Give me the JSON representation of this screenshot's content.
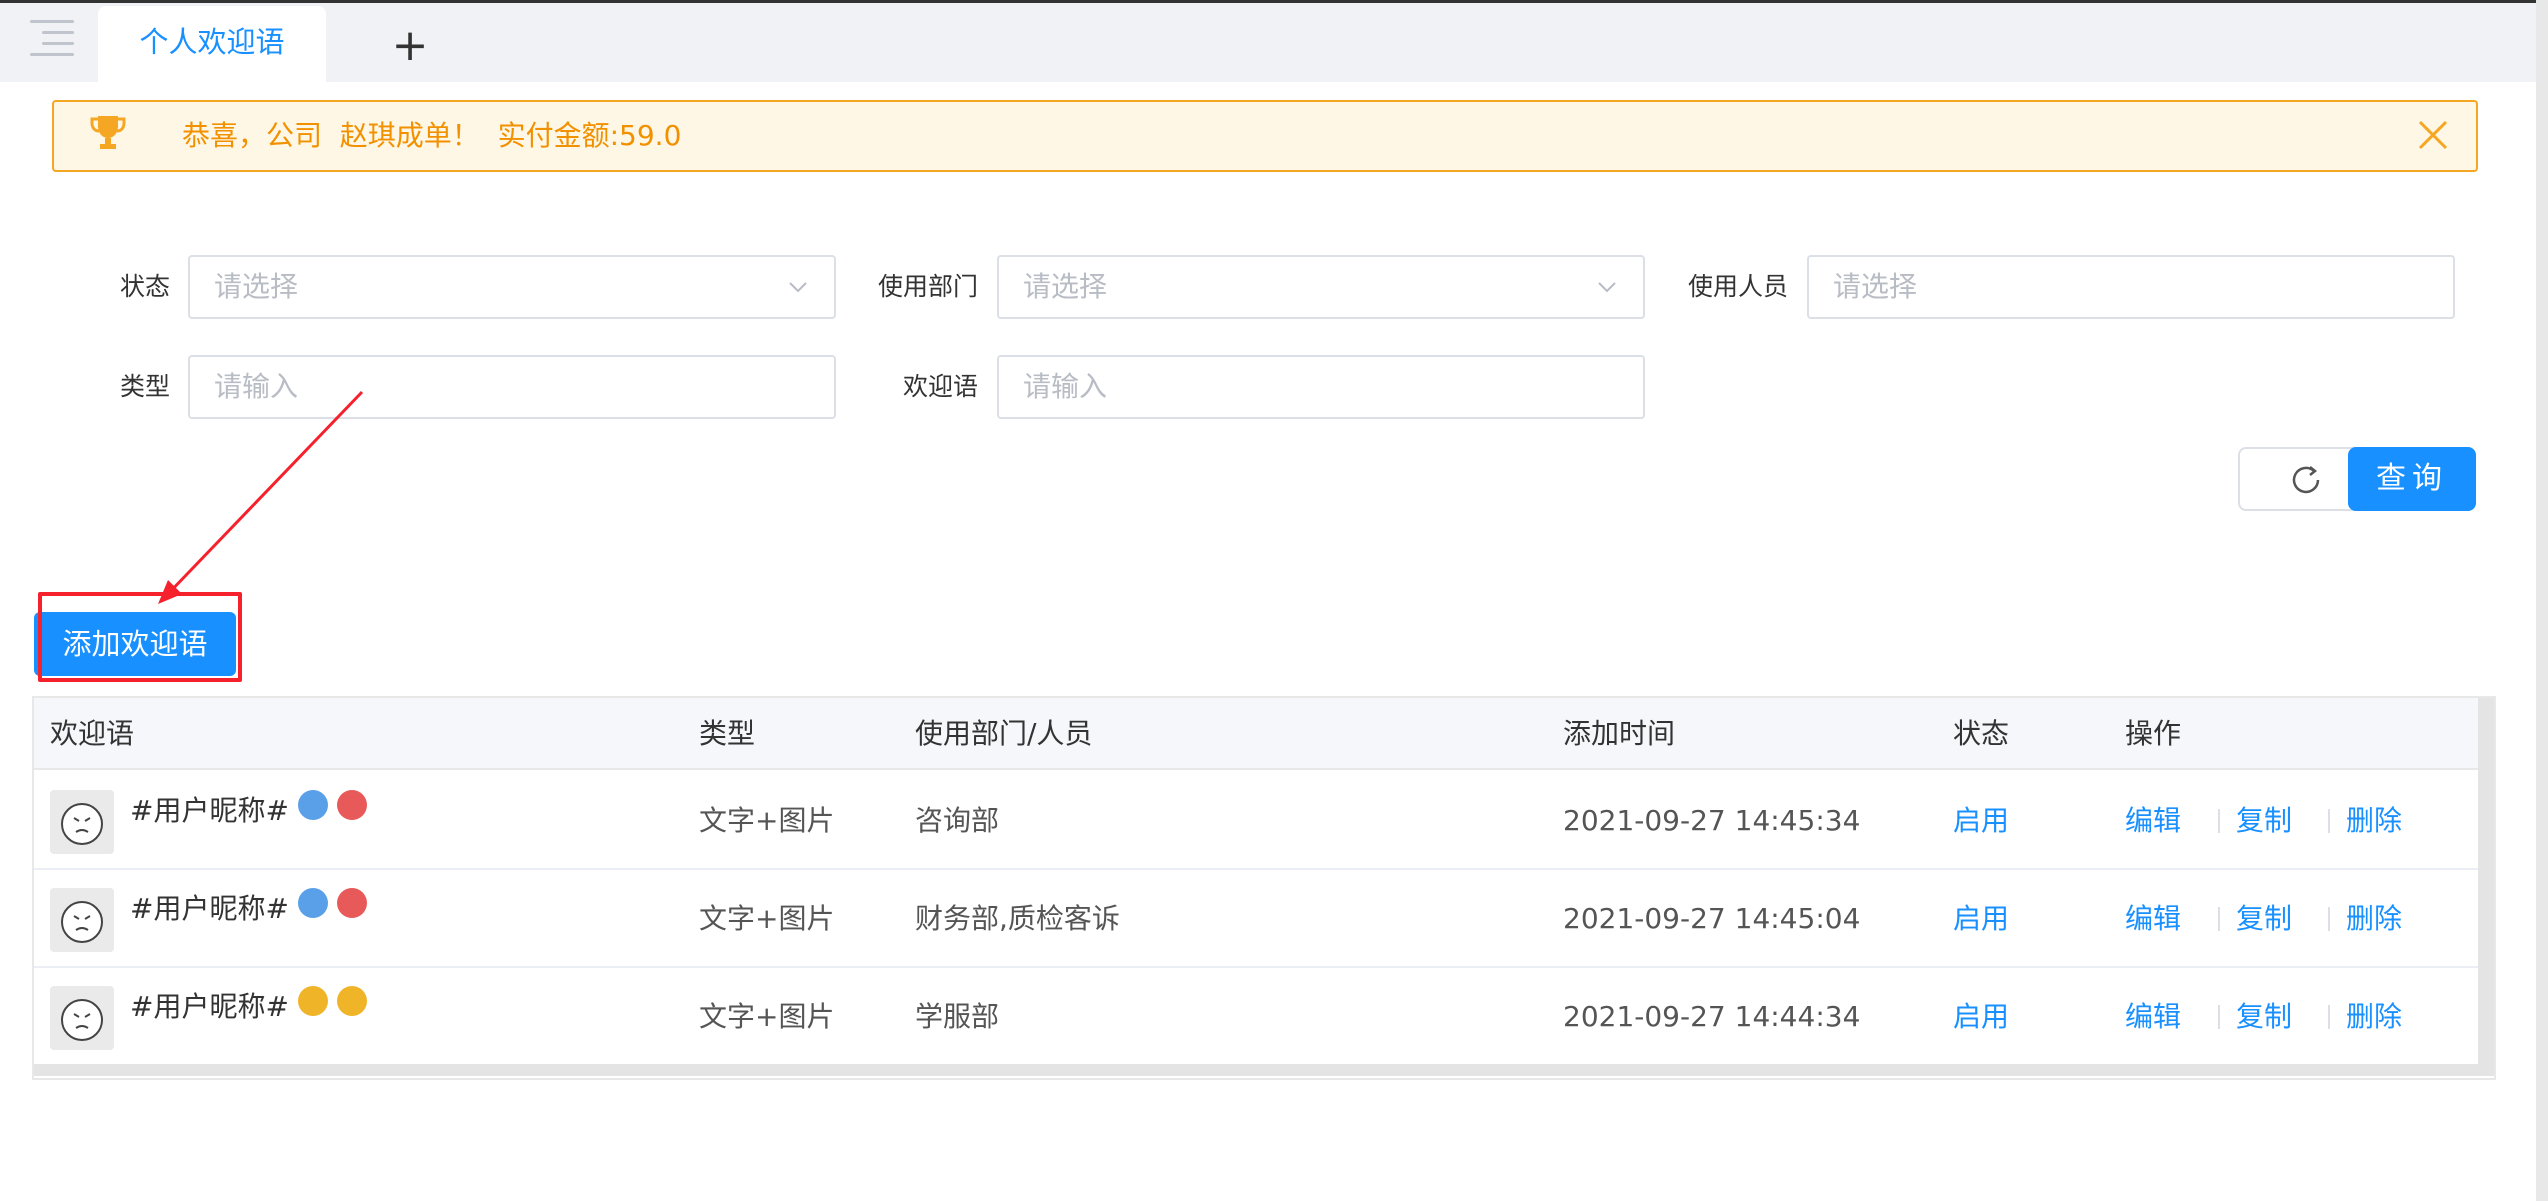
{
  "tabs": {
    "active_label": "个人欢迎语",
    "add_label": "+"
  },
  "notice": {
    "text": "恭喜，公司  赵琪成单！  实付金额:59.0"
  },
  "filters": {
    "status_label": "状态",
    "status_placeholder": "请选择",
    "dept_label": "使用部门",
    "dept_placeholder": "请选择",
    "user_label": "使用人员",
    "user_placeholder": "请选择",
    "type_label": "类型",
    "type_placeholder": "请输入",
    "welcome_label": "欢迎语",
    "welcome_placeholder": "请输入"
  },
  "buttons": {
    "query_label": "查询",
    "add_label": "添加欢迎语"
  },
  "table": {
    "headers": [
      "欢迎语",
      "类型",
      "使用部门/人员",
      "添加时间",
      "状态",
      "操作"
    ],
    "rows": [
      {
        "welcome": "#用户昵称#",
        "type": "文字+图片",
        "dept": "咨询部",
        "time": "2021-09-27 14:45:34",
        "status": "启用"
      },
      {
        "welcome": "#用户昵称#",
        "type": "文字+图片",
        "dept": "财务部,质检客诉",
        "time": "2021-09-27 14:45:04",
        "status": "启用"
      },
      {
        "welcome": "#用户昵称#",
        "type": "文字+图片",
        "dept": "学服部",
        "time": "2021-09-27 14:44:34",
        "status": "启用"
      }
    ],
    "actions": {
      "edit": "编辑",
      "copy": "复制",
      "delete": "删除"
    }
  },
  "colors": {
    "primary": "#1890ff",
    "notice_text": "#f29100",
    "notice_border": "#f5a623",
    "highlight": "#f5222d"
  }
}
